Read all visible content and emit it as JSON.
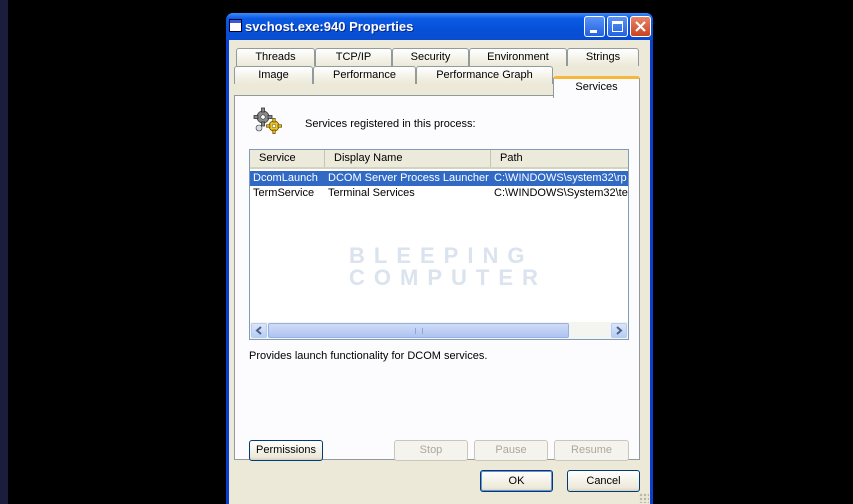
{
  "window": {
    "title": "svchost.exe:940 Properties"
  },
  "tabs_row1": [
    "Threads",
    "TCP/IP",
    "Security",
    "Environment",
    "Strings"
  ],
  "tabs_row2": [
    "Image",
    "Performance",
    "Performance Graph",
    "Services"
  ],
  "active_tab": "Services",
  "services_panel": {
    "heading": "Services registered in this process:",
    "columns": [
      "Service",
      "Display Name",
      "Path"
    ],
    "rows": [
      {
        "service": "DcomLaunch",
        "display_name": "DCOM Server Process Launcher",
        "path": "C:\\WINDOWS\\system32\\rp",
        "selected": true
      },
      {
        "service": "TermService",
        "display_name": "Terminal Services",
        "path": "C:\\WINDOWS\\System32\\te",
        "selected": false
      }
    ],
    "watermark_line1": "BLEEPING",
    "watermark_line2": "COMPUTER",
    "description": "Provides launch functionality for DCOM services."
  },
  "buttons": {
    "permissions": "Permissions",
    "stop": "Stop",
    "pause": "Pause",
    "resume": "Resume",
    "ok": "OK",
    "cancel": "Cancel"
  },
  "colors": {
    "titlebar": "#0651d8",
    "selection": "#316ac5",
    "active_tab_accent": "#f8b73a",
    "dialog_face": "#ece9d8"
  }
}
